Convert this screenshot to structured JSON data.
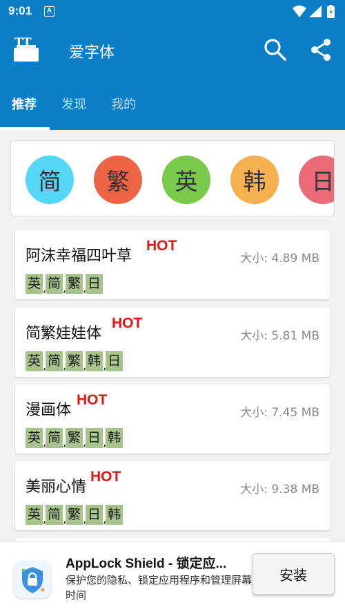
{
  "status_bar": {
    "time": "9:01",
    "notification_icon": "A"
  },
  "app_bar": {
    "title": "爱字体",
    "logo_icon": "font-logo-icon",
    "search_icon": "search-icon",
    "share_icon": "share-icon"
  },
  "tabs": [
    {
      "label": "推荐",
      "active": true
    },
    {
      "label": "发现",
      "active": false
    },
    {
      "label": "我的",
      "active": false
    }
  ],
  "categories": [
    {
      "label": "简",
      "color": "#55d6f5"
    },
    {
      "label": "繁",
      "color": "#ec6444"
    },
    {
      "label": "英",
      "color": "#79c94b"
    },
    {
      "label": "韩",
      "color": "#f6b04f"
    },
    {
      "label": "日",
      "color": "#ec6a7a"
    }
  ],
  "fonts": [
    {
      "name": "阿沫幸福四叶草",
      "badge": "HOT",
      "size": "大小: 4.89 MB",
      "tags": [
        "英",
        "简",
        "繁",
        "日"
      ]
    },
    {
      "name": "简繁娃娃体",
      "badge": "HOT",
      "size": "大小: 5.81 MB",
      "tags": [
        "英",
        "简",
        "繁",
        "韩",
        "日"
      ]
    },
    {
      "name": "漫画体",
      "badge": "HOT",
      "size": "大小: 7.45 MB",
      "tags": [
        "英",
        "简",
        "繁",
        "日",
        "韩"
      ]
    },
    {
      "name": "美丽心情",
      "badge": "HOT",
      "size": "大小: 9.38 MB",
      "tags": [
        "英",
        "简",
        "繁",
        "日",
        "韩"
      ]
    }
  ],
  "ad": {
    "title": "AppLock Shield - 锁定应...",
    "description": "保护您的隐私、锁定应用程序和管理屏幕时间",
    "install_label": "安装"
  },
  "colors": {
    "primary": "#0a7fc8",
    "hot": "#e41414",
    "tag_bg": "#a7c48d"
  }
}
